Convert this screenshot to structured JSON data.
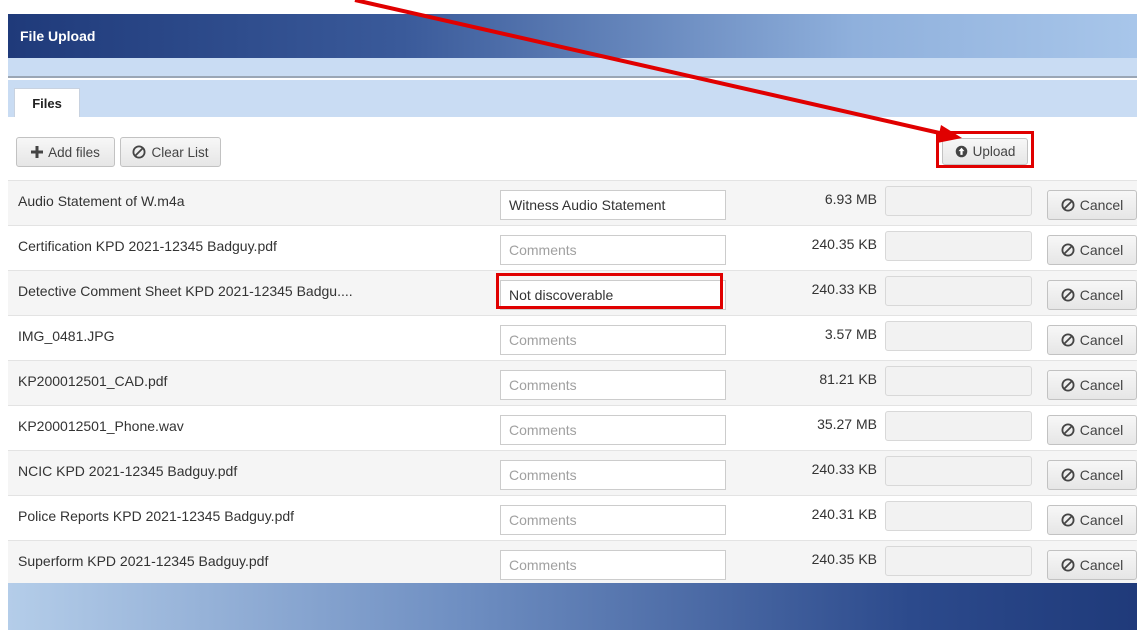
{
  "window": {
    "title": "File Upload"
  },
  "tabs": [
    {
      "label": "Files"
    }
  ],
  "toolbar": {
    "add_files_label": "Add files",
    "clear_list_label": "Clear List",
    "upload_label": "Upload"
  },
  "files": [
    {
      "name": "Audio Statement of W.m4a",
      "comment": "Witness Audio Statement",
      "size": "6.93 MB",
      "cancel": "Cancel"
    },
    {
      "name": "Certification KPD 2021-12345 Badguy.pdf",
      "comment": "",
      "size": "240.35 KB",
      "cancel": "Cancel"
    },
    {
      "name": "Detective Comment Sheet KPD 2021-12345 Badgu....",
      "comment": "Not discoverable",
      "size": "240.33 KB",
      "cancel": "Cancel"
    },
    {
      "name": "IMG_0481.JPG",
      "comment": "",
      "size": "3.57 MB",
      "cancel": "Cancel"
    },
    {
      "name": "KP200012501_CAD.pdf",
      "comment": "",
      "size": "81.21 KB",
      "cancel": "Cancel"
    },
    {
      "name": "KP200012501_Phone.wav",
      "comment": "",
      "size": "35.27 MB",
      "cancel": "Cancel"
    },
    {
      "name": "NCIC KPD 2021-12345 Badguy.pdf",
      "comment": "",
      "size": "240.33 KB",
      "cancel": "Cancel"
    },
    {
      "name": "Police Reports KPD 2021-12345 Badguy.pdf",
      "comment": "",
      "size": "240.31 KB",
      "cancel": "Cancel"
    },
    {
      "name": "Superform KPD 2021-12345 Badguy.pdf",
      "comment": "",
      "size": "240.35 KB",
      "cancel": "Cancel"
    }
  ],
  "comment_placeholder": "Comments",
  "colors": {
    "title_gradient_start": "#1f3a7a",
    "tab_strip": "#c9dcf3",
    "annotation_red": "#e00000"
  },
  "icons": {
    "add": "plus-icon",
    "clear": "ban-icon",
    "upload": "circle-up-arrow-icon",
    "cancel": "ban-icon"
  }
}
